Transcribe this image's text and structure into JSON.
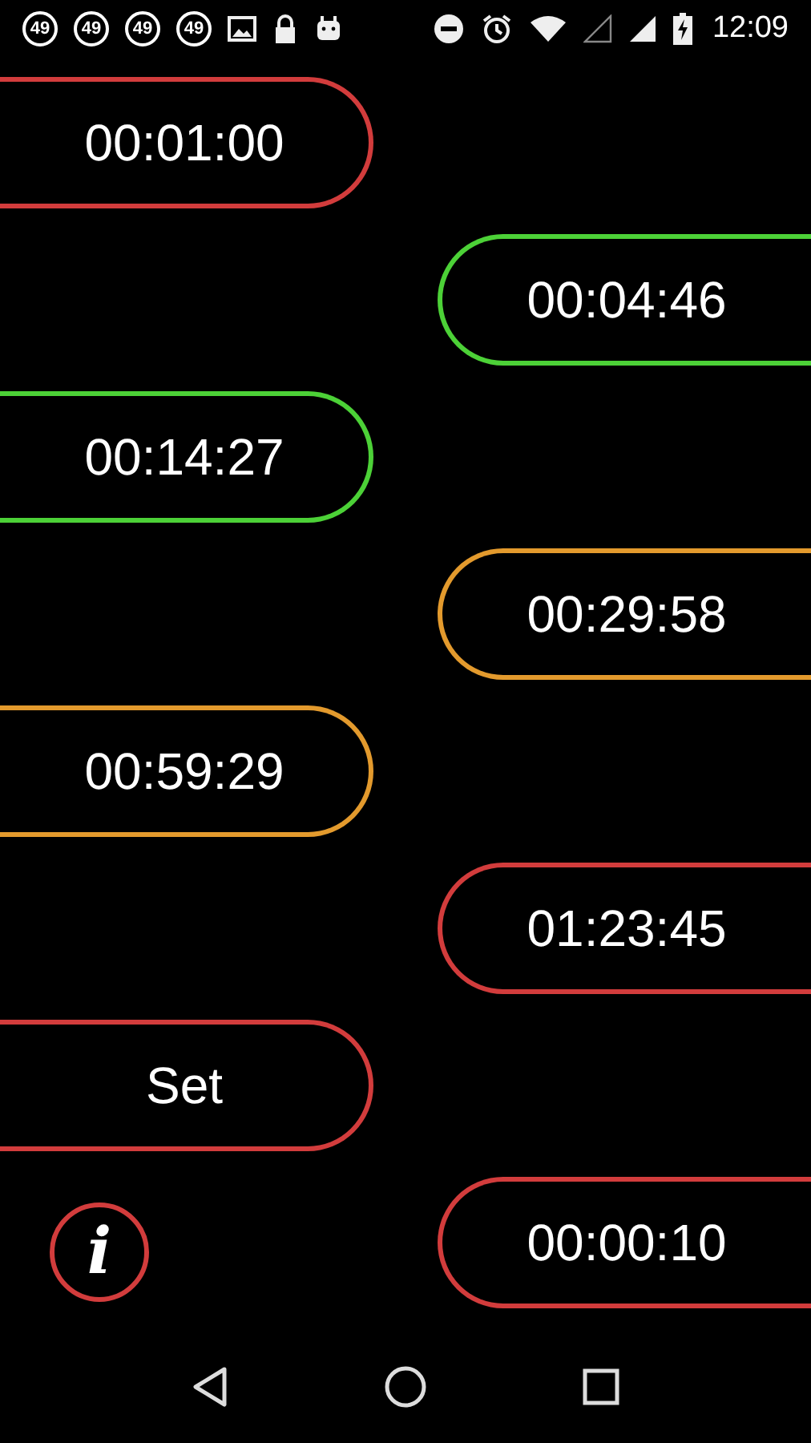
{
  "status_bar": {
    "notifications": [
      "49",
      "49",
      "49",
      "49"
    ],
    "time": "12:09"
  },
  "timers": [
    {
      "kind": "left",
      "color": "#d23c3c",
      "label": "00:01:00"
    },
    {
      "kind": "right",
      "color": "#4cd137",
      "label": "00:04:46"
    },
    {
      "kind": "left",
      "color": "#4cd137",
      "label": "00:14:27"
    },
    {
      "kind": "right",
      "color": "#e39a2d",
      "label": "00:29:58"
    },
    {
      "kind": "left",
      "color": "#e39a2d",
      "label": "00:59:29"
    },
    {
      "kind": "right",
      "color": "#d23c3c",
      "label": "01:23:45"
    },
    {
      "kind": "left",
      "color": "#d23c3c",
      "label": "Set"
    },
    {
      "kind": "right",
      "color": "#d23c3c",
      "label": "00:00:10"
    }
  ],
  "info_button": {
    "label": "i"
  }
}
